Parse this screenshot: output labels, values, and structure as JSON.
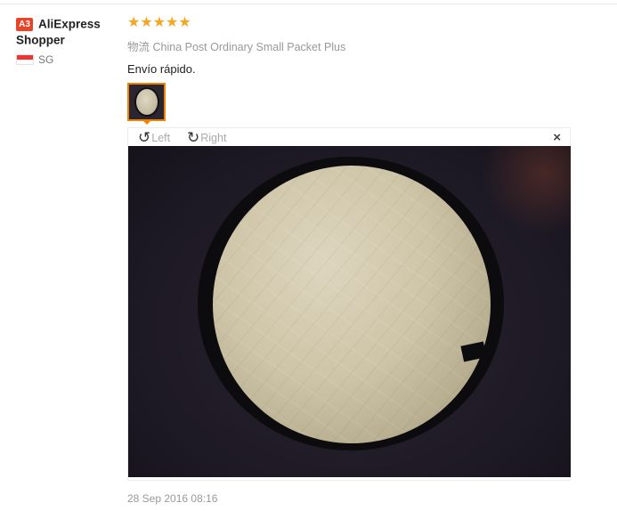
{
  "reviewer": {
    "badge": "A3",
    "name": "AliExpress Shopper",
    "country_code": "SG",
    "flag_icon": "singapore-flag-icon"
  },
  "review": {
    "rating": 5,
    "stars": "★★★★★",
    "star_color": "#f5a623",
    "logistic_label": "物流",
    "shipping_method": "China Post Ordinary Small Packet Plus",
    "feedback": "Envío rápido."
  },
  "viewer": {
    "rotate_left_label": "Left",
    "rotate_right_label": "Right",
    "close_label": "×",
    "accent_color": "#f08200"
  },
  "timestamp": "28 Sep 2016 08:16"
}
